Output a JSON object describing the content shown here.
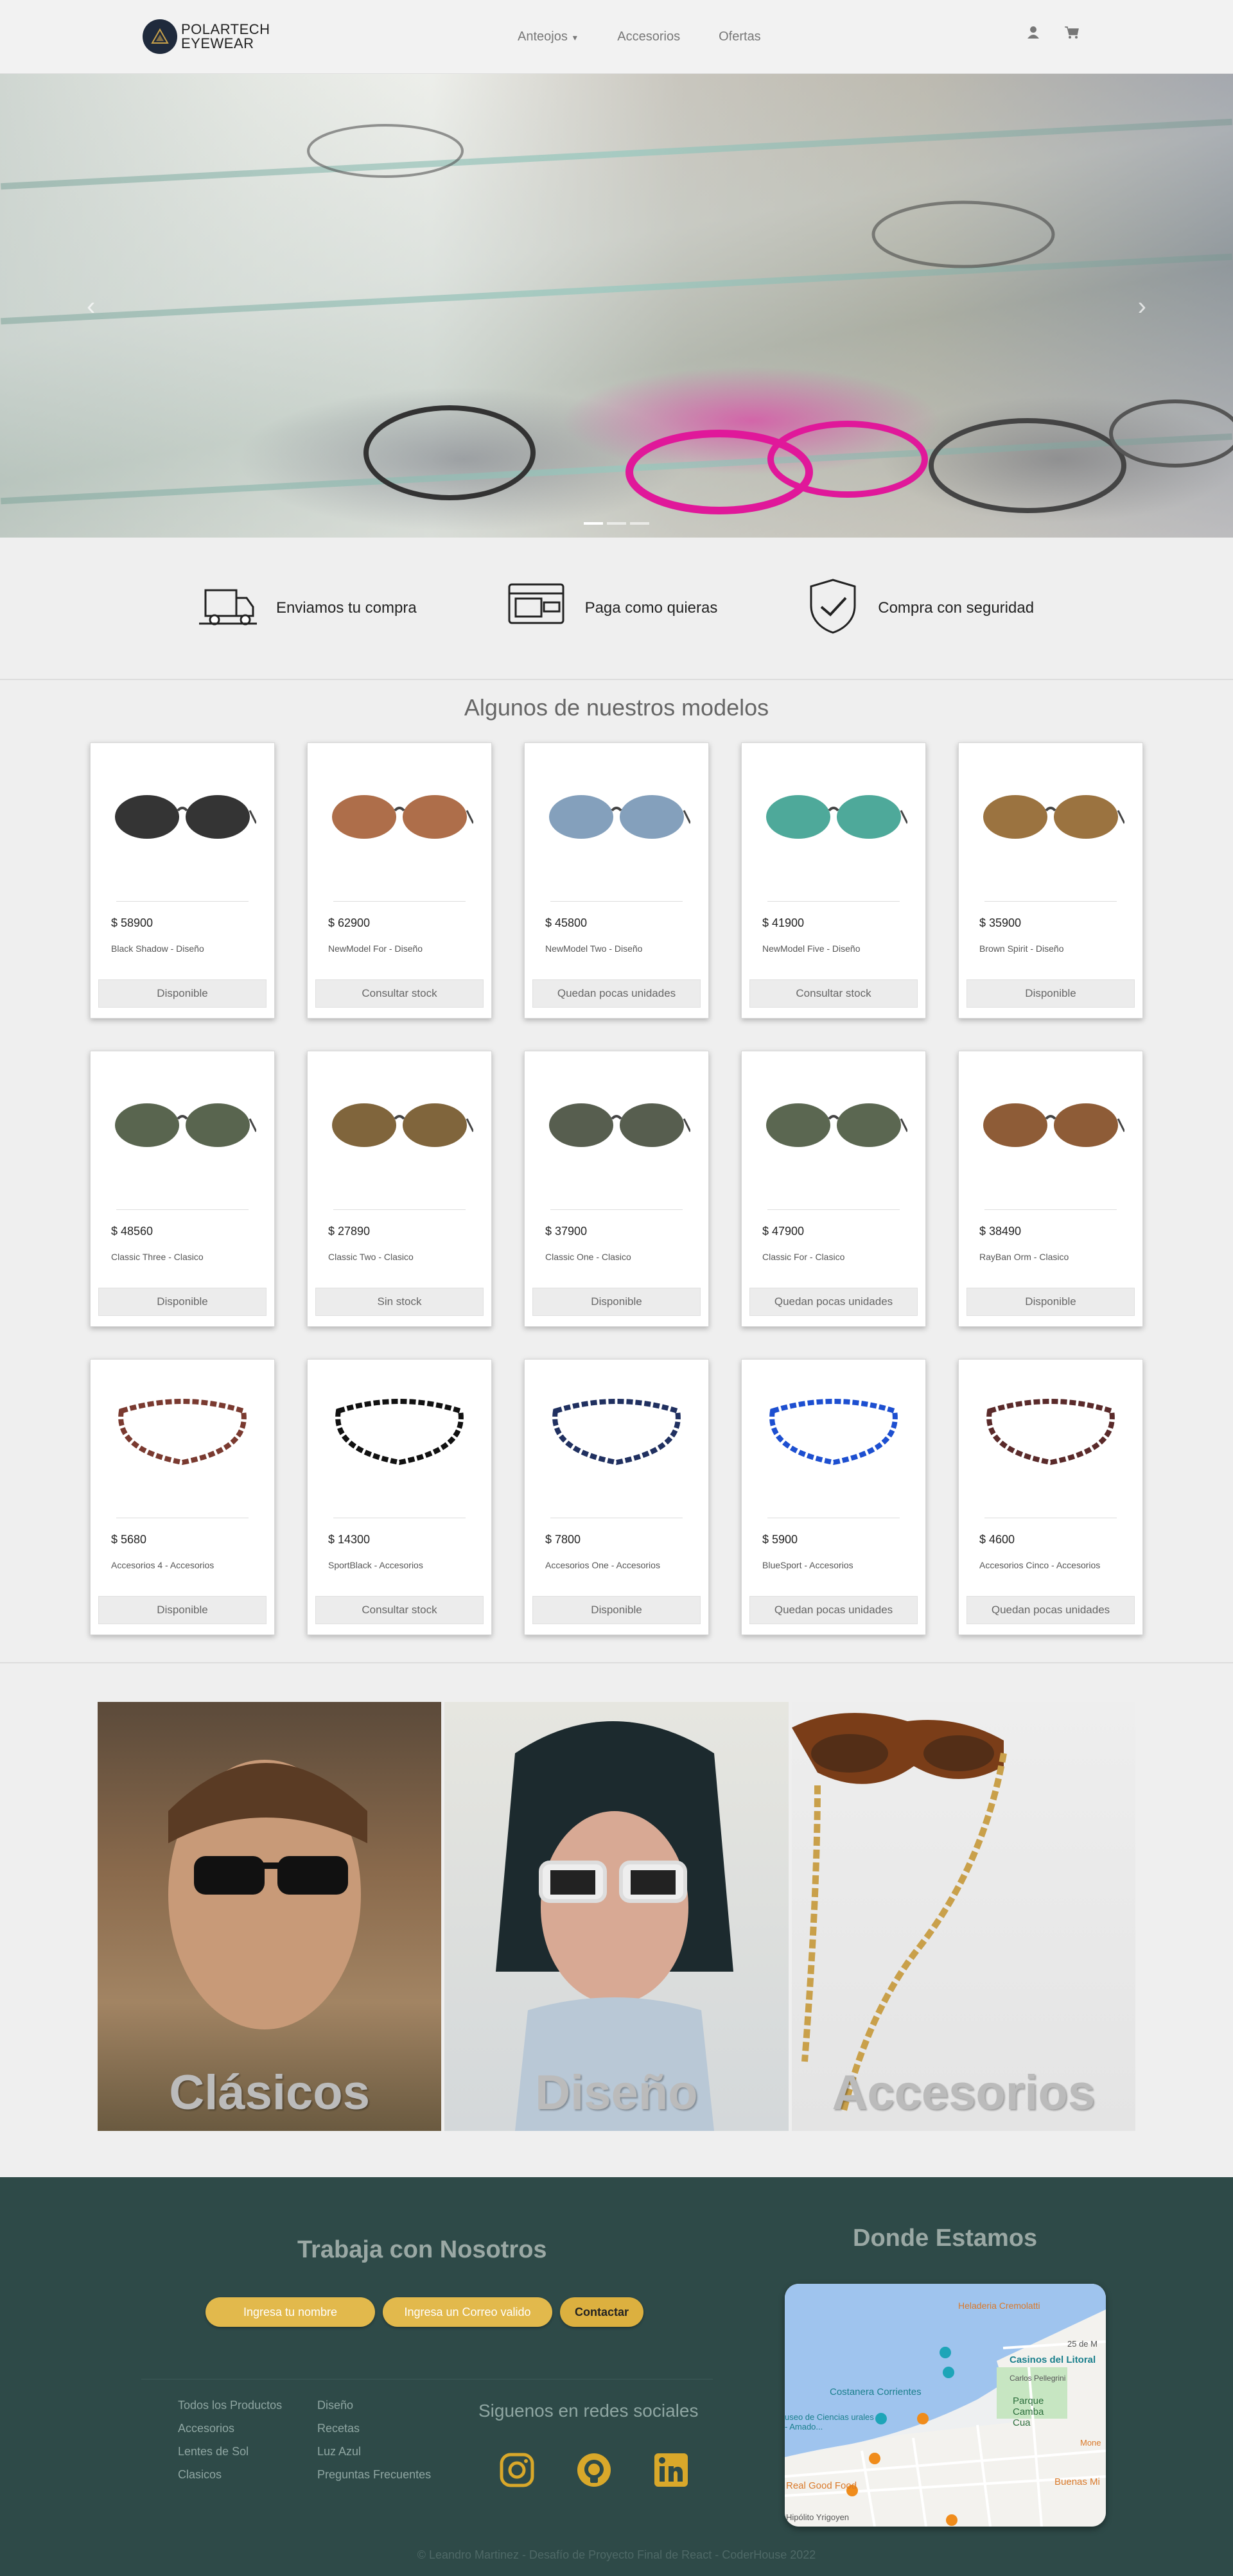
{
  "brand": {
    "line1": "POLARTECH",
    "line2": "EYEWEAR"
  },
  "nav": {
    "anteojos": "Anteojos",
    "accesorios": "Accesorios",
    "ofertas": "Ofertas"
  },
  "features": [
    {
      "label": "Enviamos tu compra",
      "icon": "truck-icon"
    },
    {
      "label": "Paga como quieras",
      "icon": "credit-card-icon"
    },
    {
      "label": "Compra con seguridad",
      "icon": "shield-check-icon"
    }
  ],
  "section_title": "Algunos de nuestros modelos",
  "products": [
    {
      "price": "$ 58900",
      "name": "Black Shadow - Diseño",
      "stock": "Disponible",
      "color": "#111111"
    },
    {
      "price": "$ 62900",
      "name": "NewModel For - Diseño",
      "stock": "Consultar stock",
      "color": "#a0552a"
    },
    {
      "price": "$ 45800",
      "name": "NewModel Two - Diseño",
      "stock": "Quedan pocas unidades",
      "color": "#6f8fb0"
    },
    {
      "price": "$ 41900",
      "name": "NewModel Five - Diseño",
      "stock": "Consultar stock",
      "color": "#2f9a88"
    },
    {
      "price": "$ 35900",
      "name": "Brown Spirit - Diseño",
      "stock": "Disponible",
      "color": "#8a5a1f"
    },
    {
      "price": "$ 48560",
      "name": "Classic Three - Clasico",
      "stock": "Disponible",
      "color": "#3c4a30"
    },
    {
      "price": "$ 27890",
      "name": "Classic Two - Clasico",
      "stock": "Sin stock",
      "color": "#6a4a1a"
    },
    {
      "price": "$ 37900",
      "name": "Classic One - Clasico",
      "stock": "Disponible",
      "color": "#3a4230"
    },
    {
      "price": "$ 47900",
      "name": "Classic For - Clasico",
      "stock": "Quedan pocas unidades",
      "color": "#3e4c32"
    },
    {
      "price": "$ 38490",
      "name": "RayBan Orm - Clasico",
      "stock": "Disponible",
      "color": "#7a3f14"
    },
    {
      "price": "$ 5680",
      "name": "Accesorios 4 - Accesorios",
      "stock": "Disponible",
      "color": "#7a3a30"
    },
    {
      "price": "$ 14300",
      "name": "SportBlack - Accesorios",
      "stock": "Consultar stock",
      "color": "#111111"
    },
    {
      "price": "$ 7800",
      "name": "Accesorios One - Accesorios",
      "stock": "Disponible",
      "color": "#203060"
    },
    {
      "price": "$ 5900",
      "name": "BlueSport - Accesorios",
      "stock": "Quedan pocas unidades",
      "color": "#1d4fd0"
    },
    {
      "price": "$ 4600",
      "name": "Accesorios Cinco - Accesorios",
      "stock": "Quedan pocas unidades",
      "color": "#5a2a2a"
    }
  ],
  "categories": [
    {
      "label": "Clásicos"
    },
    {
      "label": "Diseño"
    },
    {
      "label": "Accesorios"
    }
  ],
  "footer": {
    "work_title": "Trabaja con Nosotros",
    "name_placeholder": "Ingresa tu nombre",
    "email_placeholder": "Ingresa un Correo valido",
    "contact_button": "Contactar",
    "location_title": "Donde Estamos",
    "links_col1": [
      "Todos los Productos",
      "Accesorios",
      "Lentes de Sol",
      "Clasicos"
    ],
    "links_col2": [
      "Diseño",
      "Recetas",
      "Luz Azul",
      "Preguntas Frecuentes"
    ],
    "social_title": "Siguenos en redes sociales",
    "copyright": "© Leandro Martinez - Desafío de Proyecto Final de React - CoderHouse 2022"
  },
  "map": {
    "labels": [
      "Heladeria Cremolatti",
      "25 de M",
      "Casinos del Litoral",
      "Carlos Pellegrini",
      "Costanera Corrientes",
      "Parque Camba Cua",
      "useo de Ciencias urales - Amado...",
      "Real Good Food",
      "Buenas Mi",
      "Hipólito Yrigoyen",
      "Mone"
    ]
  },
  "colors": {
    "footer_bg": "#2e4a48",
    "pill": "#e2b94c",
    "icon_gold": "#d9a82a"
  }
}
